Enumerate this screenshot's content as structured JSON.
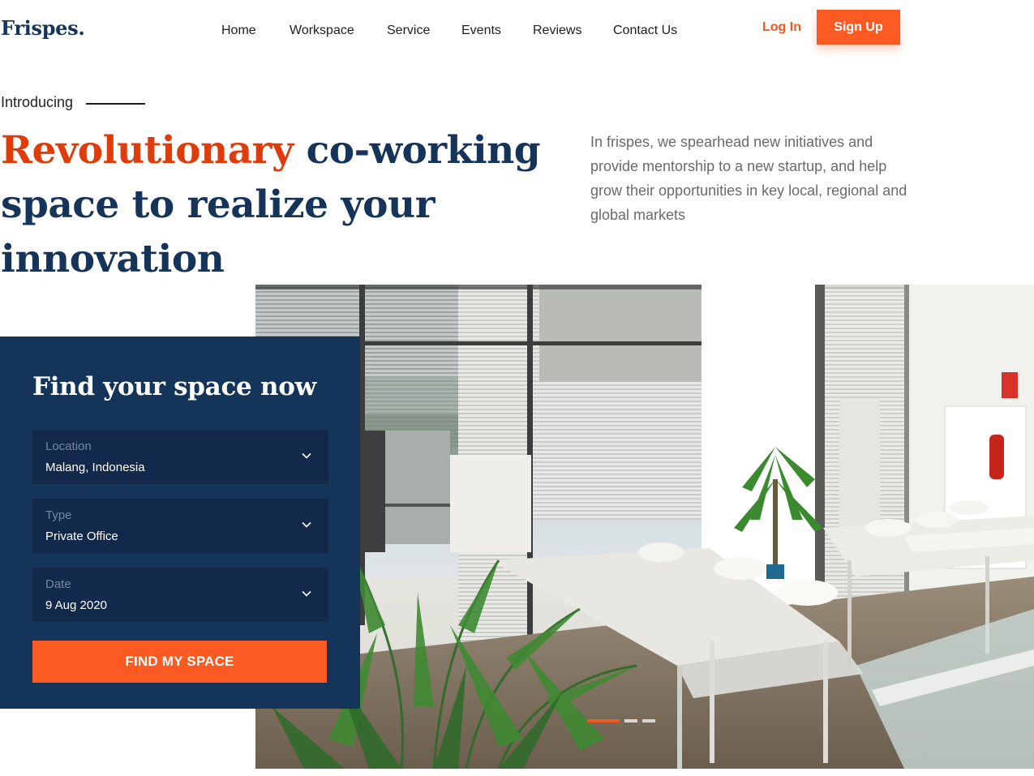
{
  "brand": {
    "logo": "Frispes."
  },
  "nav": {
    "items": [
      "Home",
      "Workspace",
      "Service",
      "Events",
      "Reviews",
      "Contact Us"
    ],
    "login": "Log In",
    "signup": "Sign Up"
  },
  "hero": {
    "eyebrow": "Introducing",
    "headline_accent": "Revolutionary",
    "headline_rest": " co-working space to realize your innovation",
    "description": "In frispes, we spearhead new initiatives and provide mentorship to a new startup, and help grow their opportunities in key local, regional and global markets"
  },
  "search": {
    "title": "Find your space now",
    "fields": [
      {
        "label": "Location",
        "value": "Malang, Indonesia"
      },
      {
        "label": "Type",
        "value": "Private Office"
      },
      {
        "label": "Date",
        "value": "9 Aug 2020"
      }
    ],
    "cta": "FIND MY SPACE"
  },
  "carousel": {
    "slides": 3,
    "active": 1
  },
  "colors": {
    "accent": "#fc5a23",
    "navy": "#15345a",
    "navy_dark": "#12294b",
    "headline_accent": "#df3c0c"
  }
}
